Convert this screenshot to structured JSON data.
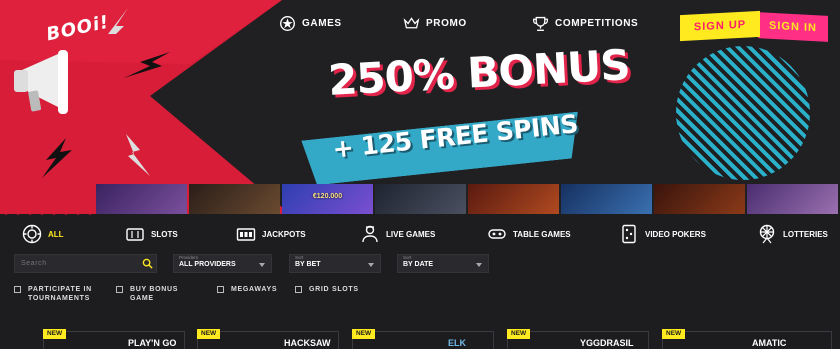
{
  "brand": {
    "logo_text": "BOOi!"
  },
  "nav": {
    "items": [
      {
        "label": "GAMES",
        "icon": "star-chip-icon"
      },
      {
        "label": "PROMO",
        "icon": "crown-icon"
      },
      {
        "label": "COMPETITIONS",
        "icon": "trophy-icon"
      }
    ],
    "signup_label": "SIGN UP",
    "signin_label": "SIGN IN"
  },
  "hero": {
    "headline": "250% BONUS",
    "subline": "+ 125 FREE SPINS",
    "colors": {
      "red": "#e01e3c",
      "cyan": "#34a9c7",
      "yellow": "#ffe91f",
      "pink": "#ff2f86"
    }
  },
  "thumbnails": [
    {
      "label": "",
      "color": "#4a2e6e"
    },
    {
      "label": "",
      "color": "#3b2a24"
    },
    {
      "label": "€120.000",
      "color": "#2e3f9b"
    },
    {
      "label": "",
      "color": "#2a2f3a"
    },
    {
      "label": "",
      "color": "#6b2418"
    },
    {
      "label": "",
      "color": "#1f3b73"
    },
    {
      "label": "",
      "color": "#4a1a12"
    },
    {
      "label": "",
      "color": "#5b3a7a"
    }
  ],
  "categories": [
    {
      "label": "ALL",
      "icon": "chip-icon",
      "active": true
    },
    {
      "label": "SLOTS",
      "icon": "slot-machine-icon"
    },
    {
      "label": "JACKPOTS",
      "icon": "jackpot-icon"
    },
    {
      "label": "LIVE GAMES",
      "icon": "dealer-icon"
    },
    {
      "label": "TABLE GAMES",
      "icon": "table-icon"
    },
    {
      "label": "VIDEO POKERS",
      "icon": "dice-icon"
    },
    {
      "label": "LOTTERIES",
      "icon": "ferris-wheel-icon"
    }
  ],
  "filters": {
    "search_placeholder": "Search",
    "providers": {
      "caption": "Providers",
      "value": "ALL PROVIDERS"
    },
    "sort1": {
      "caption": "Sort",
      "value": "BY BET"
    },
    "sort2": {
      "caption": "Sort",
      "value": "BY DATE"
    }
  },
  "checkboxes": [
    {
      "line1": "PARTICIPATE IN",
      "line2": "TOURNAMENTS"
    },
    {
      "line1": "BUY BONUS",
      "line2": "GAME"
    },
    {
      "line1": "MEGAWAYS",
      "line2": ""
    },
    {
      "line1": "GRID SLOTS",
      "line2": ""
    }
  ],
  "providers": [
    {
      "badge": "NEW",
      "name": "PLAY'N GO"
    },
    {
      "badge": "NEW",
      "name": "HACKSAW"
    },
    {
      "badge": "NEW",
      "name": "ELK"
    },
    {
      "badge": "NEW",
      "name": "YGGDRASIL"
    },
    {
      "badge": "NEW",
      "name": "AMATIC"
    }
  ]
}
